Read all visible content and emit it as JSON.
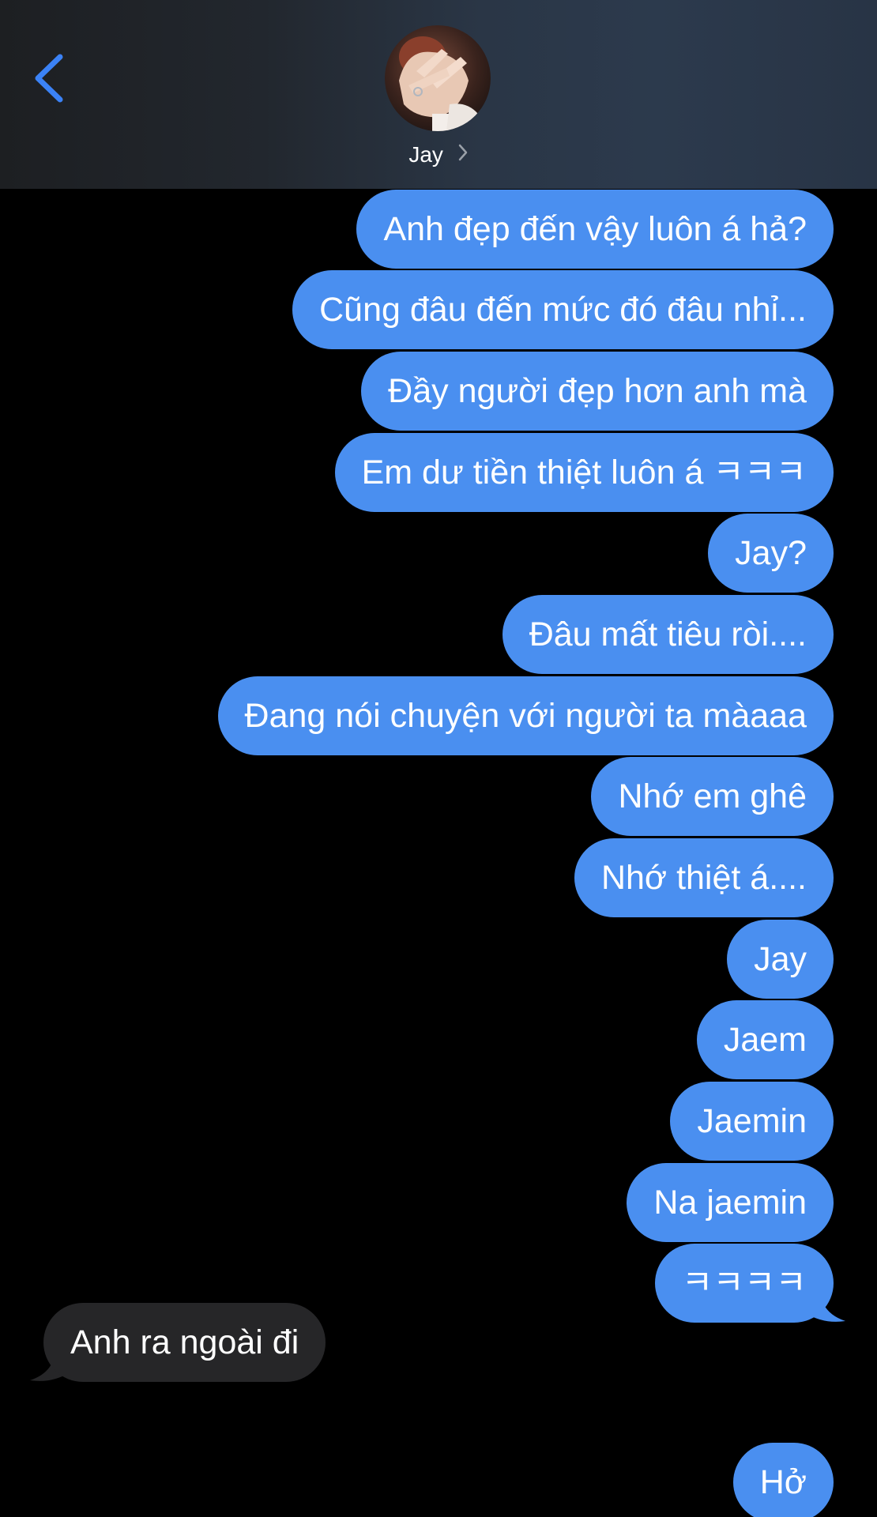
{
  "header": {
    "contact_name": "Jay",
    "back_icon": "chevron-left-icon",
    "detail_icon": "chevron-right-icon",
    "avatar_icon": "contact-photo"
  },
  "colors": {
    "sent_bubble": "#4a8ff0",
    "received_bubble": "#262628",
    "accent": "#3b82f6",
    "background": "#000000"
  },
  "messages": [
    {
      "from": "me",
      "text": "Anh đẹp đến vậy luôn á hả?"
    },
    {
      "from": "me",
      "text": "Cũng đâu đến mức đó đâu nhỉ..."
    },
    {
      "from": "me",
      "text": "Đầy người đẹp hơn anh mà"
    },
    {
      "from": "me",
      "text": "Em dư tiền thiệt luôn á ㅋㅋㅋ"
    },
    {
      "from": "me",
      "text": "Jay?"
    },
    {
      "from": "me",
      "text": "Đâu mất tiêu ròi...."
    },
    {
      "from": "me",
      "text": "Đang nói chuyện với người ta màaaa"
    },
    {
      "from": "me",
      "text": "Nhớ em ghê"
    },
    {
      "from": "me",
      "text": "Nhớ thiệt á...."
    },
    {
      "from": "me",
      "text": "Jay"
    },
    {
      "from": "me",
      "text": "Jaem"
    },
    {
      "from": "me",
      "text": "Jaemin"
    },
    {
      "from": "me",
      "text": "Na jaemin"
    },
    {
      "from": "me",
      "text": "ㅋㅋㅋㅋ"
    },
    {
      "from": "them",
      "text": "Anh ra ngoài đi"
    },
    {
      "from": "me",
      "text": "Hở"
    }
  ]
}
